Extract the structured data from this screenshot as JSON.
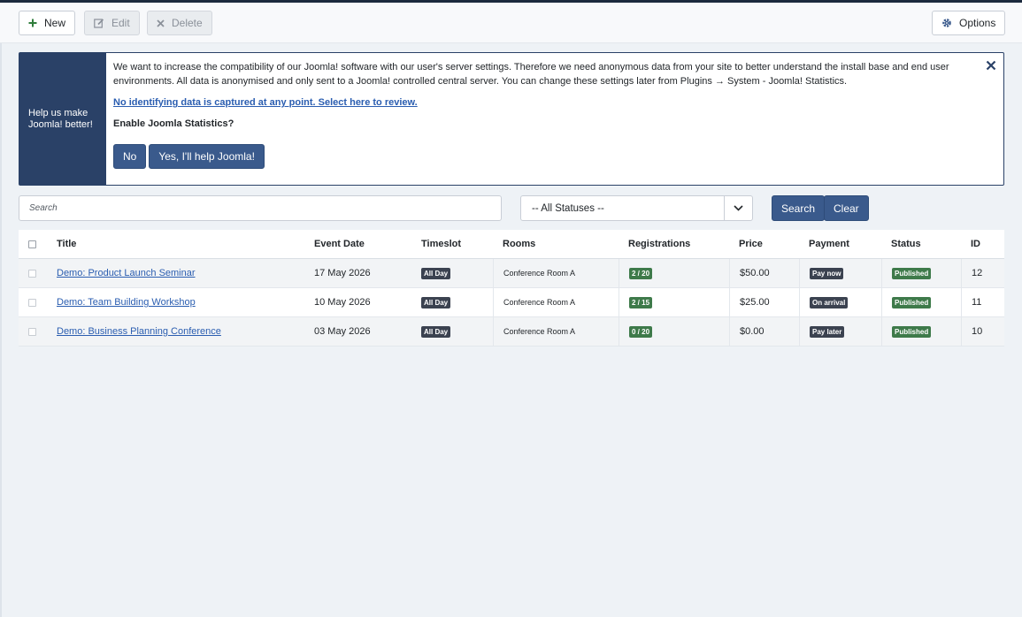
{
  "toolbar": {
    "new_label": "New",
    "edit_label": "Edit",
    "delete_label": "Delete",
    "options_label": "Options"
  },
  "stats_message": {
    "side_title": "Help us make Joomla! better!",
    "text": "We want to increase the compatibility of our Joomla! software with our user's server settings. Therefore we need anonymous data from your site to better understand the install base and end user environments. All data is anonymised and only sent to a Joomla! controlled central server. You can change these settings later from Plugins → System - Joomla! Statistics.",
    "link": "No identifying data is captured at any point. Select here to review.",
    "question": "Enable Joomla Statistics?",
    "no_label": "No",
    "yes_label": "Yes, I'll help Joomla!"
  },
  "filters": {
    "search_placeholder": "Search",
    "status_value": "-- All Statuses --",
    "search_button": "Search",
    "clear_button": "Clear"
  },
  "table": {
    "columns": {
      "title": "Title",
      "event_date": "Event Date",
      "timeslot": "Timeslot",
      "rooms": "Rooms",
      "registrations": "Registrations",
      "price": "Price",
      "payment": "Payment",
      "status": "Status",
      "id": "ID"
    },
    "rows": [
      {
        "title": "Demo: Product Launch Seminar",
        "event_date": "17 May 2026",
        "timeslot": "All Day",
        "rooms": "Conference Room A",
        "registrations": "2 / 20",
        "price": "$50.00",
        "payment": "Pay now",
        "status": "Published",
        "id": "12"
      },
      {
        "title": "Demo: Team Building Workshop",
        "event_date": "10 May 2026",
        "timeslot": "All Day",
        "rooms": "Conference Room A",
        "registrations": "2 / 15",
        "price": "$25.00",
        "payment": "On arrival",
        "status": "Published",
        "id": "11"
      },
      {
        "title": "Demo: Business Planning Conference",
        "event_date": "03 May 2026",
        "timeslot": "All Day",
        "rooms": "Conference Room A",
        "registrations": "0 / 20",
        "price": "$0.00",
        "payment": "Pay later",
        "status": "Published",
        "id": "10"
      }
    ]
  },
  "colors": {
    "accent": "#2a4167",
    "button": "#3a5a8c",
    "published": "#3e7a4a",
    "badge_dark": "#3b4250",
    "link": "#2a5db0"
  }
}
